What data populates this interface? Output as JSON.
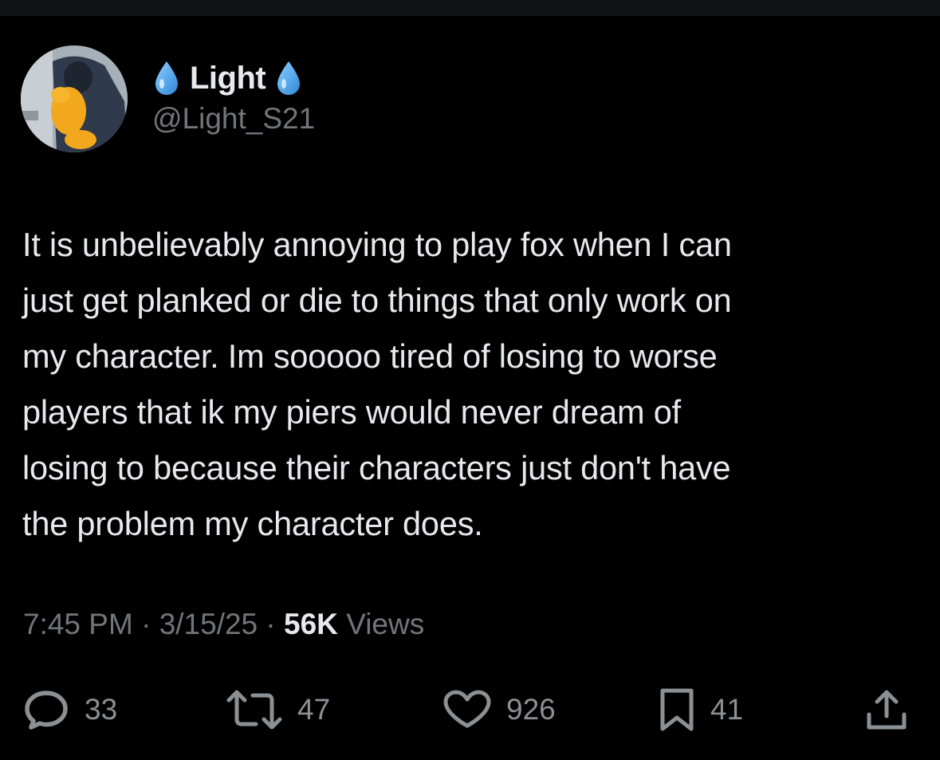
{
  "tweet": {
    "display_name": "Light",
    "handle": "@Light_S21",
    "badge_icon": "droplet-icon",
    "text": "It is unbelievably annoying to play fox when I can\njust get planked or die to things that only work on\nmy character.  Im sooooo tired of losing to worse\nplayers that ik my piers would never dream of\nlosing to because their characters just don't have\nthe problem my character does.",
    "time": "7:45 PM",
    "date": "3/15/25",
    "separator": "·",
    "views_count": "56K",
    "views_label": "Views"
  },
  "actions": {
    "replies": "33",
    "reposts": "47",
    "likes": "926",
    "bookmarks": "41"
  },
  "colors": {
    "background": "#000000",
    "text_primary": "#e7e9ea",
    "text_secondary": "#71767b",
    "droplet": "#4aa8e8"
  }
}
